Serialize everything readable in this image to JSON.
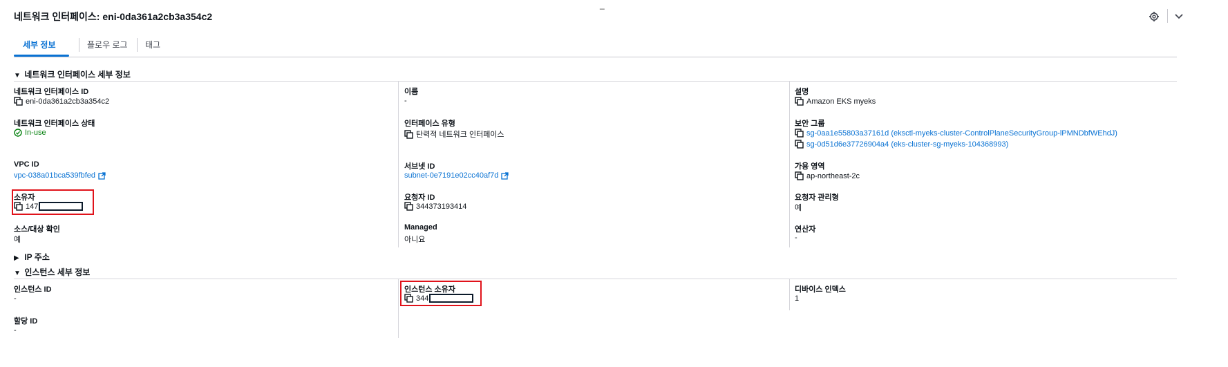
{
  "header": {
    "title": "네트워크 인터페이스: eni-0da361a2cb3a354c2",
    "minimize_glyph": "_"
  },
  "tabs": [
    {
      "label": "세부 정보"
    },
    {
      "label": "플로우 로그"
    },
    {
      "label": "태그"
    }
  ],
  "sections": {
    "details": {
      "title": "네트워크 인터페이스 세부 정보",
      "expanded_glyph": "▼"
    },
    "ip": {
      "title": "IP 주소",
      "collapsed_glyph": "▶"
    },
    "instance": {
      "title": "인스턴스 세부 정보",
      "expanded_glyph": "▼"
    }
  },
  "details": {
    "eni_id": {
      "label": "네트워크 인터페이스 ID",
      "value": "eni-0da361a2cb3a354c2"
    },
    "name": {
      "label": "이름",
      "value": "-"
    },
    "description": {
      "label": "설명",
      "value": "Amazon EKS myeks"
    },
    "status": {
      "label": "네트워크 인터페이스 상태",
      "value": "In-use"
    },
    "if_type": {
      "label": "인터페이스 유형",
      "value": "탄력적 네트워크 인터페이스"
    },
    "security_groups": {
      "label": "보안 그룹",
      "items": [
        "sg-0aa1e55803a37161d (eksctl-myeks-cluster-ControlPlaneSecurityGroup-lPMNDbfWEhdJ)",
        "sg-0d51d6e37726904a4 (eks-cluster-sg-myeks-104368993)"
      ]
    },
    "vpc_id": {
      "label": "VPC ID",
      "value": "vpc-038a01bca539fbfed"
    },
    "subnet_id": {
      "label": "서브넷 ID",
      "value": "subnet-0e7191e02cc40af7d"
    },
    "az": {
      "label": "가용 영역",
      "value": "ap-northeast-2c"
    },
    "owner": {
      "label": "소유자",
      "value": "147"
    },
    "requester_id": {
      "label": "요청자 ID",
      "value": "344373193414"
    },
    "requester_managed": {
      "label": "요청자 관리형",
      "value": "예"
    },
    "source_dest": {
      "label": "소스/대상 확인",
      "value": "예"
    },
    "managed": {
      "label": "Managed",
      "value": "아니요"
    },
    "operator": {
      "label": "연산자",
      "value": "-"
    }
  },
  "instance": {
    "instance_id": {
      "label": "인스턴스 ID",
      "value": "-"
    },
    "instance_owner": {
      "label": "인스턴스 소유자",
      "value": "344"
    },
    "device_index": {
      "label": "디바이스 인덱스",
      "value": "1"
    },
    "attachment_id": {
      "label": "할당 ID",
      "value": "-"
    }
  },
  "colors": {
    "accent": "#0972d3",
    "success": "#037f0c",
    "highlight": "#e0121a"
  }
}
